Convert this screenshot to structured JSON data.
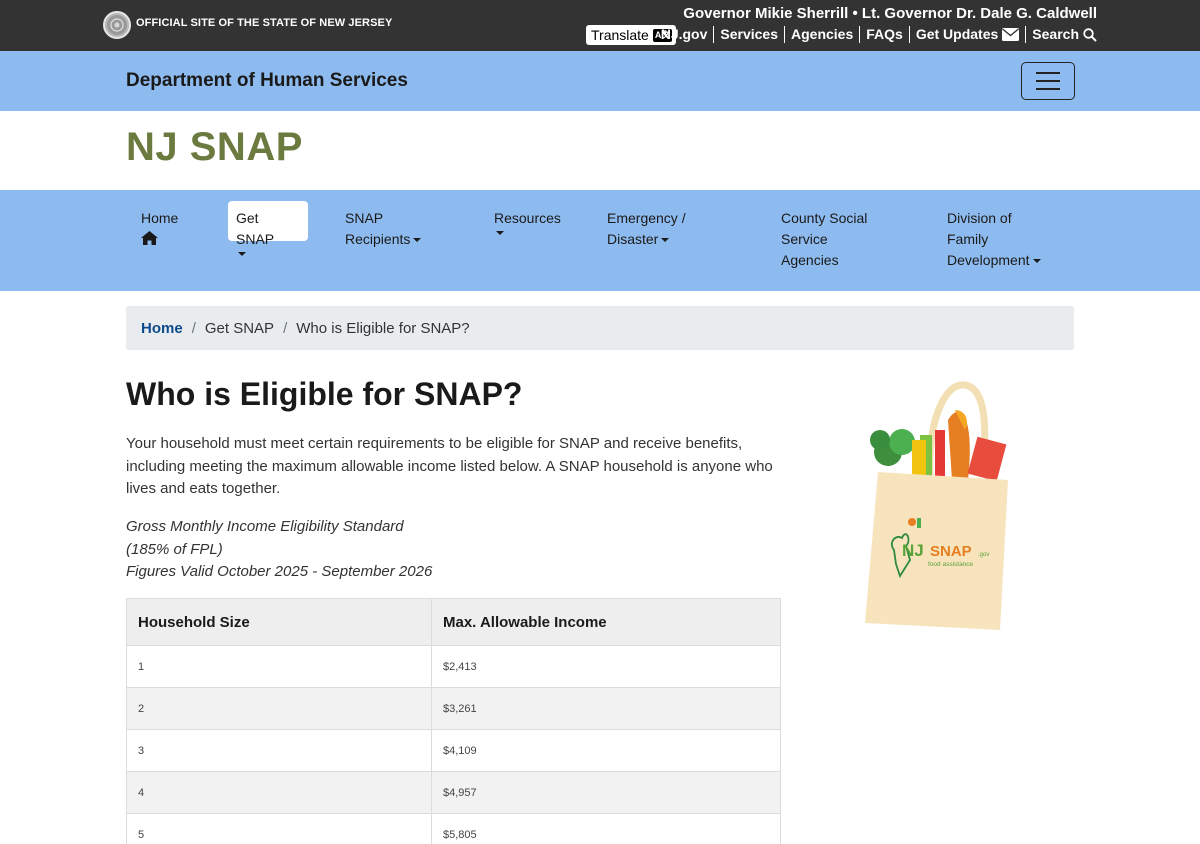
{
  "topbar": {
    "official_text": "OFFICIAL SITE OF THE STATE OF NEW JERSEY",
    "governor_line": "Governor Mikie Sherrill • Lt. Governor Dr. Dale G. Caldwell",
    "translate_label": "Translate",
    "translate_icon_text": "A文",
    "links": {
      "njgov": "NJ.gov",
      "services": "Services",
      "agencies": "Agencies",
      "faqs": "FAQs",
      "updates": "Get Updates",
      "search": "Search"
    }
  },
  "dept": {
    "title": "Department of Human Services"
  },
  "site": {
    "title": "NJ SNAP"
  },
  "nav": {
    "home": "Home",
    "get_snap": "Get SNAP",
    "recipients_1": "SNAP",
    "recipients_2": "Recipients",
    "resources": "Resources",
    "emergency_1": "Emergency /",
    "emergency_2": "Disaster",
    "county_1": "County Social",
    "county_2": "Service",
    "county_3": "Agencies",
    "dfd_1": "Division of",
    "dfd_2": "Family",
    "dfd_3": "Development"
  },
  "breadcrumb": {
    "home": "Home",
    "get_snap": "Get SNAP",
    "current": "Who is Eligible for SNAP?"
  },
  "page": {
    "title": "Who is Eligible for SNAP?",
    "intro": "Your household must meet certain requirements to be eligible for SNAP and receive benefits, including meeting the maximum allowable income listed below. A SNAP household is anyone who lives and eats together.",
    "standard_1": "Gross Monthly Income Eligibility Standard",
    "standard_2": "(185% of FPL)",
    "standard_3": "Figures Valid October 2025 - September 2026"
  },
  "table": {
    "headers": [
      "Household Size",
      "Max. Allowable Income"
    ],
    "rows": [
      [
        "1",
        "$2,413"
      ],
      [
        "2",
        "$3,261"
      ],
      [
        "3",
        "$4,109"
      ],
      [
        "4",
        "$4,957"
      ],
      [
        "5",
        "$5,805"
      ]
    ]
  },
  "bag_logo": {
    "nj": "NJ",
    "snap": "SNAP",
    "gov": ".gov",
    "tagline": "food assistance"
  },
  "colors": {
    "topbar": "#333333",
    "accent_blue": "#8ebbef",
    "title_green": "#6b7a3e",
    "link_blue": "#0d4b8c"
  }
}
